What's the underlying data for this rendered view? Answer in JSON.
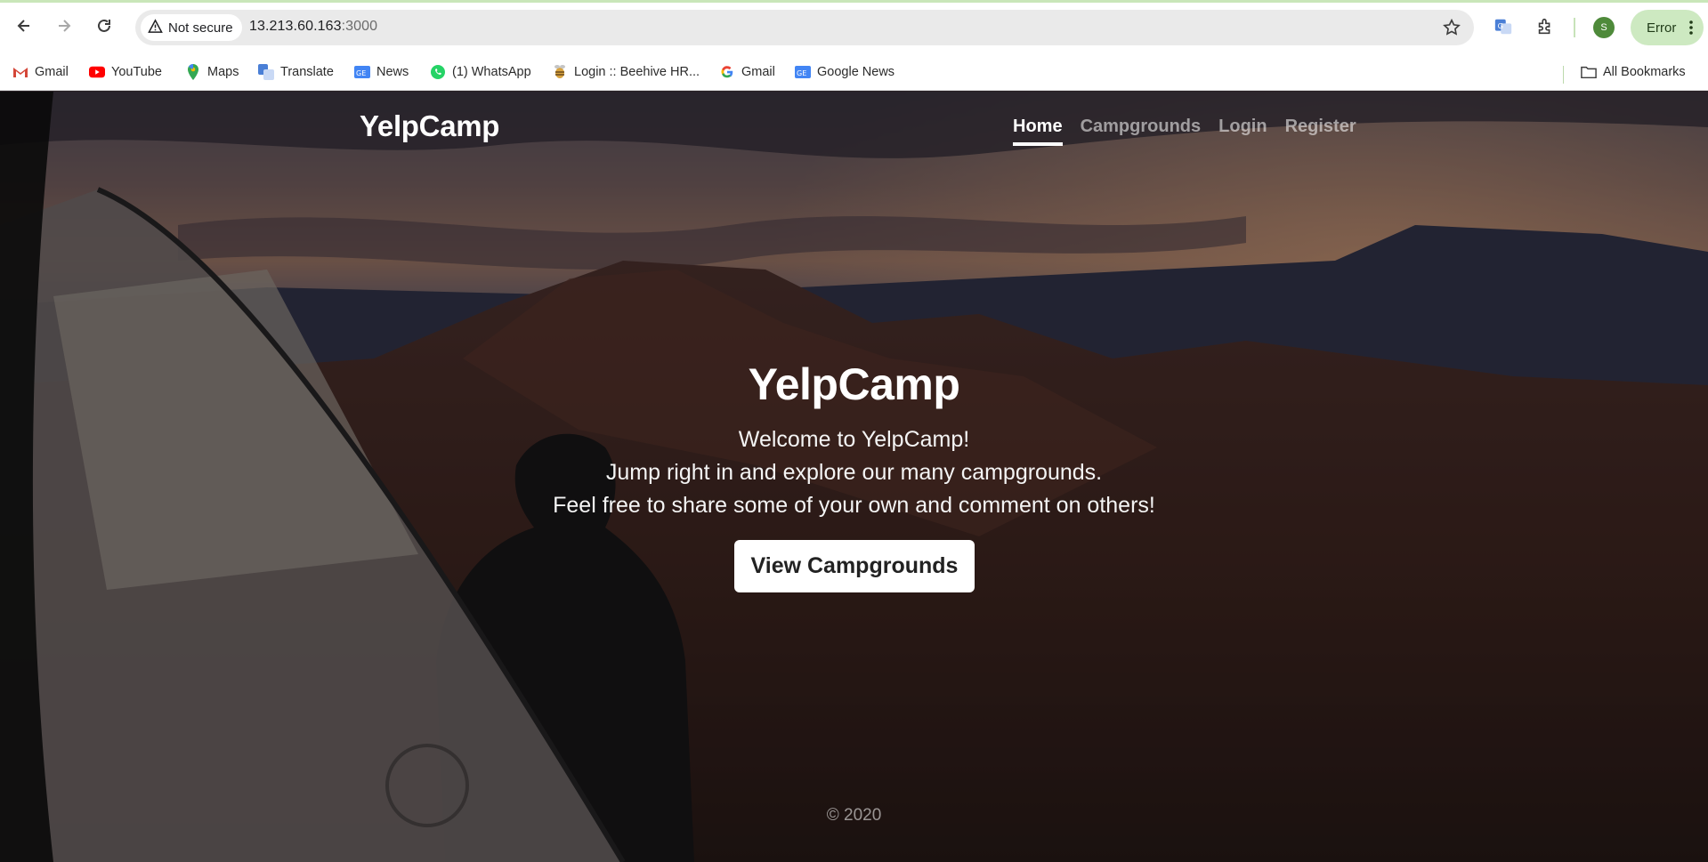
{
  "browser": {
    "security_label": "Not secure",
    "url_host": "13.213.60.163",
    "url_port": ":3000",
    "profile_initial": "S",
    "status_chip": "Error",
    "icons": {
      "back": "back-arrow-icon",
      "forward": "forward-arrow-icon",
      "reload": "reload-icon",
      "warning": "warning-triangle-icon",
      "bookmark_star": "star-icon",
      "translate": "translate-icon",
      "extensions": "puzzle-icon",
      "menu": "kebab-menu-icon"
    }
  },
  "bookmarks": {
    "items": [
      {
        "label": "Gmail",
        "icon": "gmail-icon"
      },
      {
        "label": "YouTube",
        "icon": "youtube-icon"
      },
      {
        "label": "Maps",
        "icon": "maps-pin-icon"
      },
      {
        "label": "Translate",
        "icon": "translate-icon"
      },
      {
        "label": "News",
        "icon": "google-news-icon"
      },
      {
        "label": "(1) WhatsApp",
        "icon": "whatsapp-icon"
      },
      {
        "label": "Login :: Beehive HR...",
        "icon": "beehive-icon"
      },
      {
        "label": "Gmail",
        "icon": "google-g-icon"
      },
      {
        "label": "Google News",
        "icon": "google-news-icon"
      }
    ],
    "all_bookmarks": "All Bookmarks"
  },
  "site": {
    "brand": "YelpCamp",
    "nav": [
      {
        "label": "Home",
        "active": true
      },
      {
        "label": "Campgrounds",
        "active": false
      },
      {
        "label": "Login",
        "active": false
      },
      {
        "label": "Register",
        "active": false
      }
    ],
    "hero": {
      "title": "YelpCamp",
      "lines": [
        "Welcome to YelpCamp!",
        "Jump right in and explore our many campgrounds.",
        "Feel free to share some of your own and comment on others!"
      ],
      "cta": "View Campgrounds"
    },
    "footer": "© 2020"
  }
}
